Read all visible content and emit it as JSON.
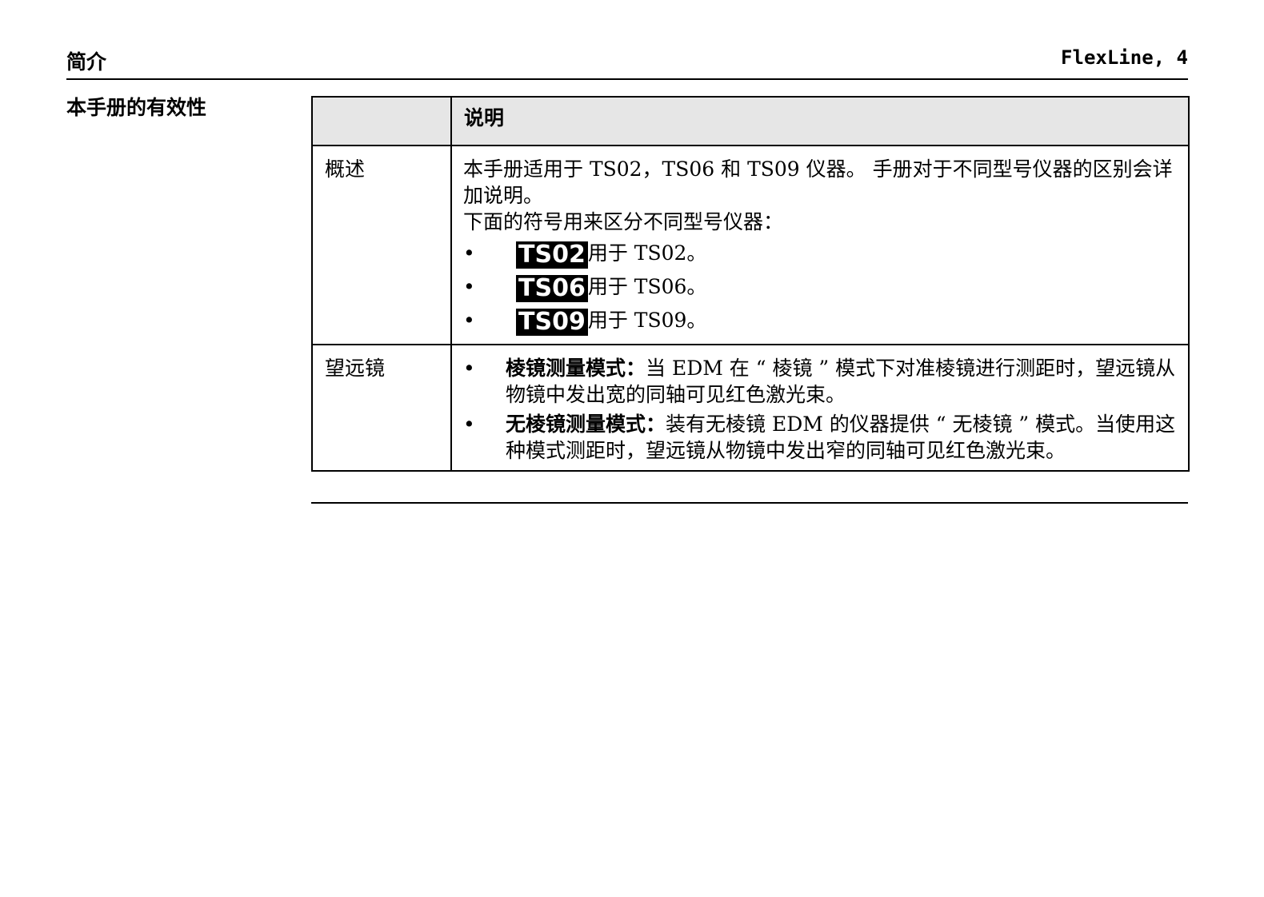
{
  "header": {
    "section": "简介",
    "product_page": "FlexLine, 4"
  },
  "section_title": "本手册的有效性",
  "table": {
    "column_header": "说明",
    "overview": {
      "label": "概述",
      "text_1": "本手册适用于 TS02，TS06 和 TS09 仪器。 手册对于不同型号仪器的区别会详加说明。",
      "text_2": "下面的符号用来区分不同型号仪器：",
      "models": [
        {
          "badge": "TS02",
          "text": "用于 TS02。"
        },
        {
          "badge": "TS06",
          "text": "用于 TS06。"
        },
        {
          "badge": "TS09",
          "text": "用于 TS09。"
        }
      ]
    },
    "telescope": {
      "label": "望远镜",
      "modes": [
        {
          "term": "棱镜测量模式：",
          "text": "当 EDM 在 “ 棱镜 ” 模式下对准棱镜进行测距时，望远镜从物镜中发出宽的同轴可见红色激光束。"
        },
        {
          "term": "无棱镜测量模式：",
          "text": "装有无棱镜 EDM 的仪器提供 “ 无棱镜 ” 模式。当使用这种模式测距时，望远镜从物镜中发出窄的同轴可见红色激光束。"
        }
      ]
    }
  },
  "bullet": "•"
}
